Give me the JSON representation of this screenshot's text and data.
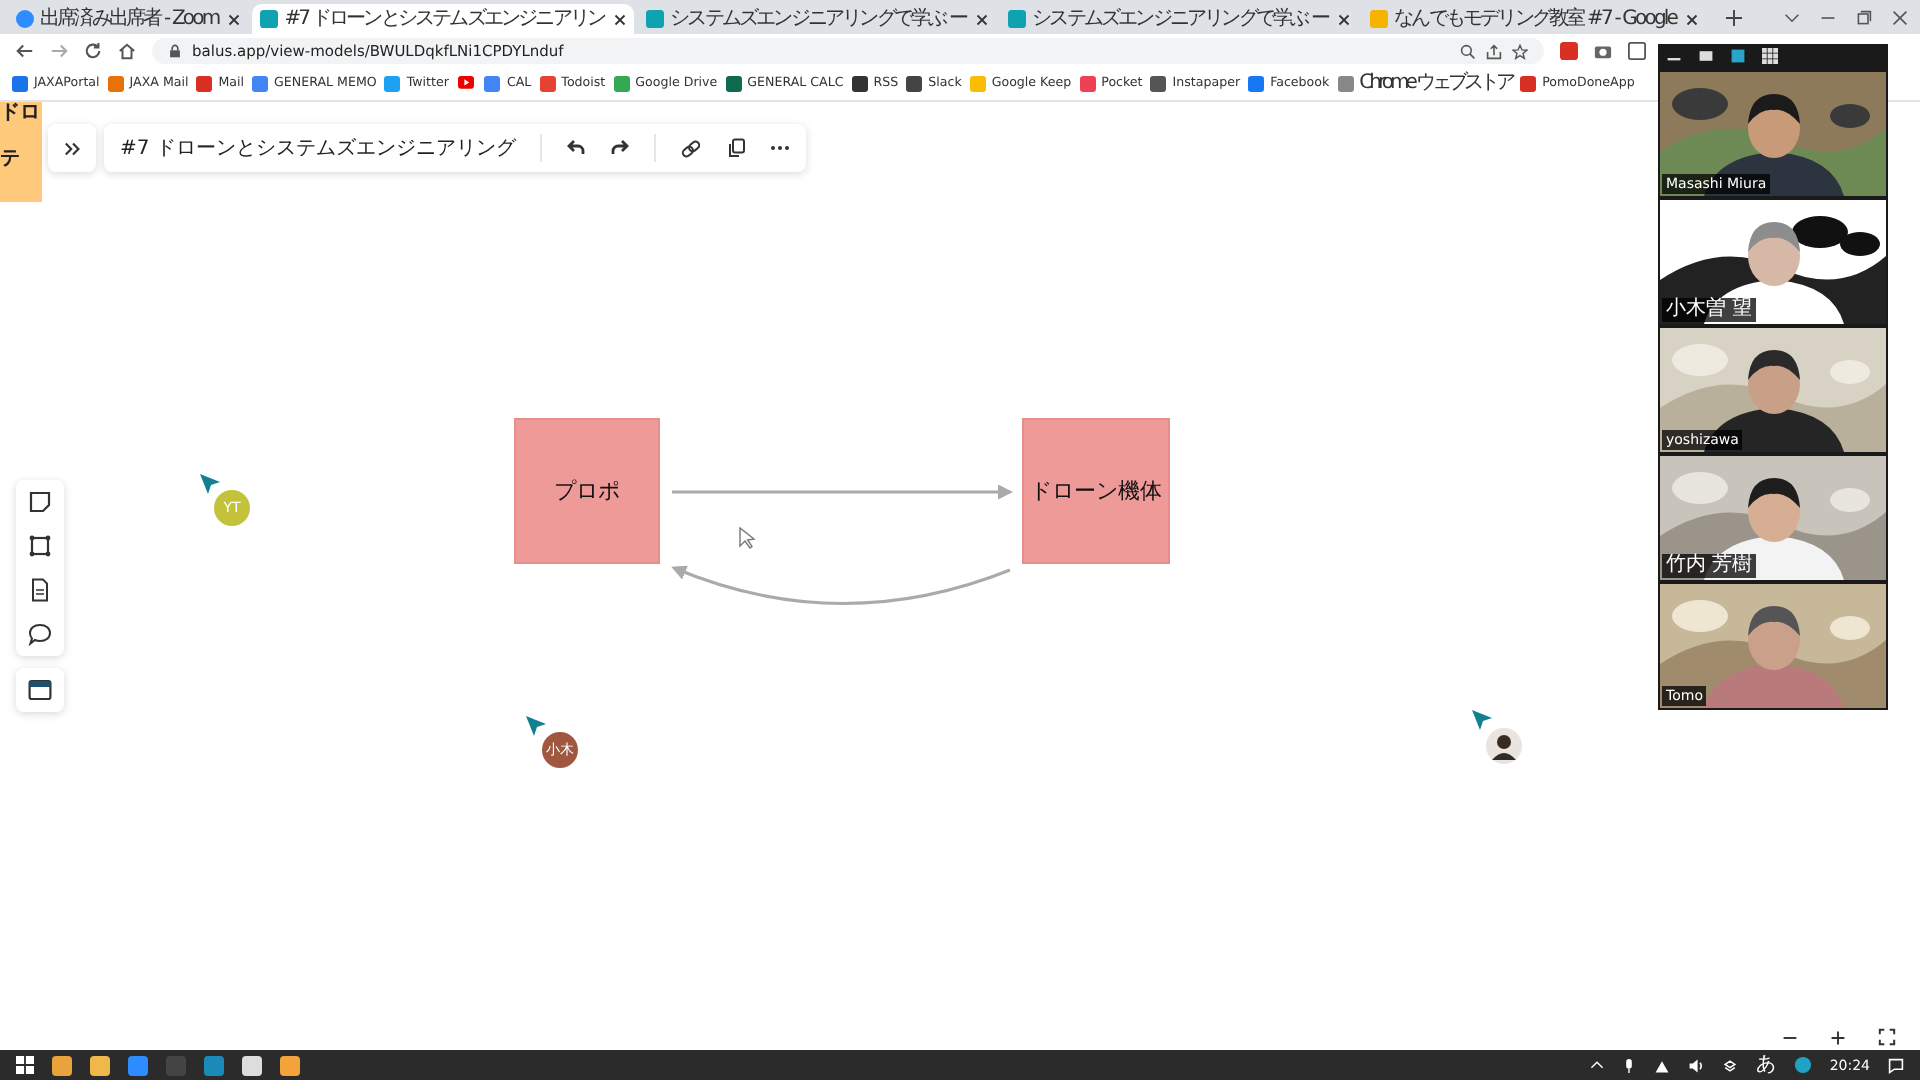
{
  "browser": {
    "tabs": [
      {
        "title": "出席済み出席者 - Zoom",
        "selected": false
      },
      {
        "title": "#7 ドローンとシステムズエンジニアリン",
        "selected": true
      },
      {
        "title": "システムズエンジニアリングで学ぶ ー",
        "selected": false
      },
      {
        "title": "システムズエンジニアリングで学ぶ ー",
        "selected": false
      },
      {
        "title": "なんでもモデリング教室 #7 - Google",
        "selected": false
      }
    ],
    "url": "balus.app/view-models/BWULDqkfLNi1CPDYLnduf",
    "bookmarks": [
      {
        "kind": "link",
        "label": "JAXAPortal"
      },
      {
        "kind": "link",
        "label": "JAXA Mail"
      },
      {
        "kind": "link",
        "label": "Mail"
      },
      {
        "kind": "link",
        "label": "GENERAL MEMO"
      },
      {
        "kind": "link",
        "label": "Twitter"
      },
      {
        "kind": "icon"
      },
      {
        "kind": "link",
        "label": "CAL"
      },
      {
        "kind": "link",
        "label": "Todoist"
      },
      {
        "kind": "link",
        "label": "Google Drive"
      },
      {
        "kind": "link",
        "label": "GENERAL CALC"
      },
      {
        "kind": "link",
        "label": "RSS"
      },
      {
        "kind": "link",
        "label": "Slack"
      },
      {
        "kind": "link",
        "label": "Google Keep"
      },
      {
        "kind": "link",
        "label": "Pocket"
      },
      {
        "kind": "link",
        "label": "Instapaper"
      },
      {
        "kind": "link",
        "label": "Facebook"
      },
      {
        "kind": "link",
        "label": "Chrome ウェブストア"
      },
      {
        "kind": "link",
        "label": "PomoDoneApp"
      }
    ]
  },
  "canvas": {
    "sticky_note": [
      "ドロ",
      "テ"
    ],
    "toolbar": {
      "title": "#7 ドローンとシステムズエンジニアリング"
    },
    "nodes": [
      {
        "label": "プロポ"
      },
      {
        "label": "ドローン機体"
      }
    ],
    "collaborators": [
      {
        "kind": "initials",
        "initials": "YT",
        "color": "#c3c23a"
      },
      {
        "kind": "initials",
        "initials": "小木",
        "color": "#a0573f"
      },
      {
        "kind": "avatar"
      }
    ]
  },
  "zoom": {
    "participants": [
      {
        "name": "Masashi Miura"
      },
      {
        "name": "小木曽 望"
      },
      {
        "name": "yoshizawa"
      },
      {
        "name": "竹内 芳樹"
      },
      {
        "name": "Tomo"
      }
    ]
  },
  "taskbar": {
    "ime": "あ",
    "clock": "20:24"
  }
}
